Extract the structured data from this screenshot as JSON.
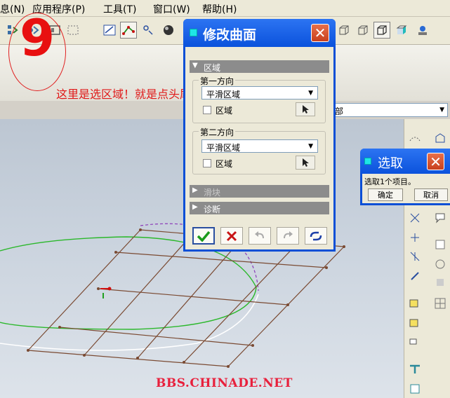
{
  "menu": [
    "息(N)",
    "应用程序(P)",
    "工具(T)",
    "窗口(W)",
    "帮助(H)"
  ],
  "annotation": {
    "number": "9",
    "note": "这里是选区域！就是点头尾的两两条控制线！"
  },
  "watermark": "BBS.CHINADE.NET",
  "toolbar_combo_value": "部",
  "dialog": {
    "title": "修改曲面",
    "section_region": "区域",
    "dir1_title": "第一方向",
    "dir1_combo_value": "平滑区域",
    "dir1_checkbox": "区域",
    "dir2_title": "第二方向",
    "dir2_combo_value": "平滑区域",
    "dir2_checkbox": "区域",
    "section_slider": "滑块",
    "section_diagnose": "诊断"
  },
  "select_dialog": {
    "title": "选取",
    "message": "选取1个项目。",
    "ok": "确定",
    "cancel": "取消"
  },
  "colors": {
    "title_blue": "#0b52dc",
    "accent_red": "#e01818",
    "ok_green": "#1a9a1a",
    "cancel_red": "#c81414"
  }
}
